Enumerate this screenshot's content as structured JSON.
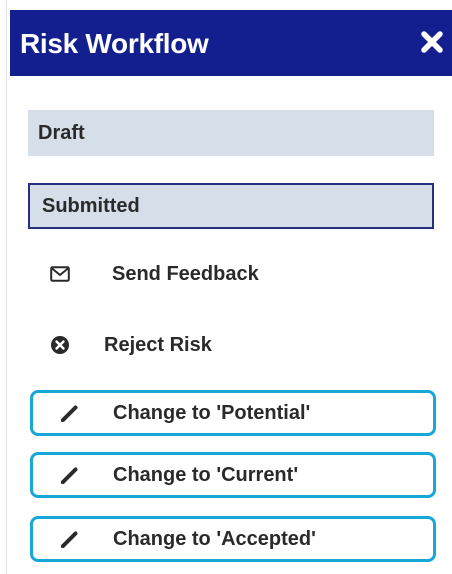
{
  "header": {
    "title": "Risk Workflow",
    "close_icon": "close-icon"
  },
  "states": [
    {
      "label": "Draft",
      "selected": false
    },
    {
      "label": "Submitted",
      "selected": true
    }
  ],
  "actions": {
    "send_feedback": {
      "label": "Send Feedback",
      "icon": "envelope-icon"
    },
    "reject_risk": {
      "label": "Reject Risk",
      "icon": "circle-x-icon"
    }
  },
  "change_buttons": [
    {
      "label": "Change to 'Potential'",
      "icon": "pencil-icon"
    },
    {
      "label": "Change to 'Current'",
      "icon": "pencil-icon"
    },
    {
      "label": "Change to 'Accepted'",
      "icon": "pencil-icon"
    }
  ],
  "colors": {
    "header_bg": "#141f8f",
    "state_bg": "#d5dee9",
    "selected_border": "#26307f",
    "button_border": "#18a8d8",
    "text": "#2a2a2a"
  }
}
